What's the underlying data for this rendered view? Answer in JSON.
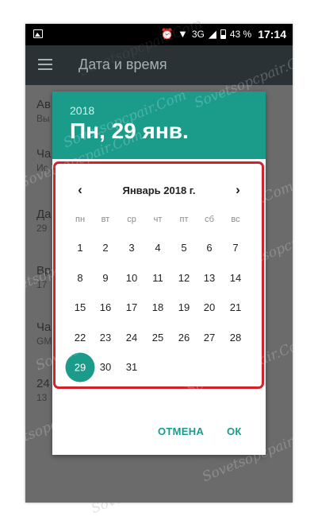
{
  "status_bar": {
    "network": "3G",
    "battery": "43 %",
    "time": "17:14"
  },
  "app_bar": {
    "title": "Дата и время"
  },
  "settings": {
    "rows": [
      {
        "title": "Ав",
        "subtitle": "Вы"
      },
      {
        "title": "Ча",
        "subtitle": "Ис"
      },
      {
        "title": "Да",
        "subtitle": "29"
      },
      {
        "title": "Вр",
        "subtitle": "17"
      },
      {
        "title": "Ча",
        "subtitle": "GM"
      },
      {
        "title": "24",
        "subtitle": "13"
      }
    ]
  },
  "dialog": {
    "year": "2018",
    "date": "Пн, 29 янв.",
    "month_title": "Январь 2018 г.",
    "weekdays": [
      "пн",
      "вт",
      "ср",
      "чт",
      "пт",
      "сб",
      "вс"
    ],
    "weeks": [
      [
        "1",
        "2",
        "3",
        "4",
        "5",
        "6",
        "7"
      ],
      [
        "8",
        "9",
        "10",
        "11",
        "12",
        "13",
        "14"
      ],
      [
        "15",
        "16",
        "17",
        "18",
        "19",
        "20",
        "21"
      ],
      [
        "22",
        "23",
        "24",
        "25",
        "26",
        "27",
        "28"
      ],
      [
        "29",
        "30",
        "31"
      ]
    ],
    "selected_day": "29",
    "cancel_label": "ОТМЕНА",
    "ok_label": "ОК",
    "prev_icon": "chevron-left-icon",
    "next_icon": "chevron-right-icon"
  },
  "watermark": "Sovetsopcpair.Com",
  "colors": {
    "accent": "#1b9c8b",
    "highlight": "#d0222b"
  }
}
